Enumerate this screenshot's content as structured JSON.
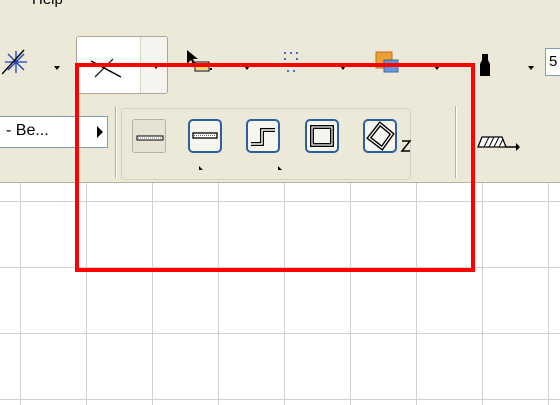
{
  "menubar": {
    "help_label": "Help"
  },
  "toolbar1": {
    "tools": [
      {
        "name": "snap-burst-icon"
      },
      {
        "name": "line-tool-icon",
        "pressed": true
      },
      {
        "name": "arrow-pointer-icon"
      },
      {
        "name": "dotted-grid-icon"
      },
      {
        "name": "layer-color-icon"
      },
      {
        "name": "pen-icon"
      }
    ],
    "scale_field_value": "5"
  },
  "toolbar2": {
    "combo_value": "- Be...",
    "geometry_methods": [
      {
        "name": "single-line-icon"
      },
      {
        "name": "straight-line-icon"
      },
      {
        "name": "polyline-step-icon"
      },
      {
        "name": "rectangle-icon"
      },
      {
        "name": "rotated-rectangle-icon"
      }
    ],
    "hatch_icon": "hatch-arrow-icon"
  },
  "colors": {
    "highlight": "#ff0000",
    "selected_border": "#2b5ea3",
    "toolbar_bg": "#ece9d8"
  }
}
